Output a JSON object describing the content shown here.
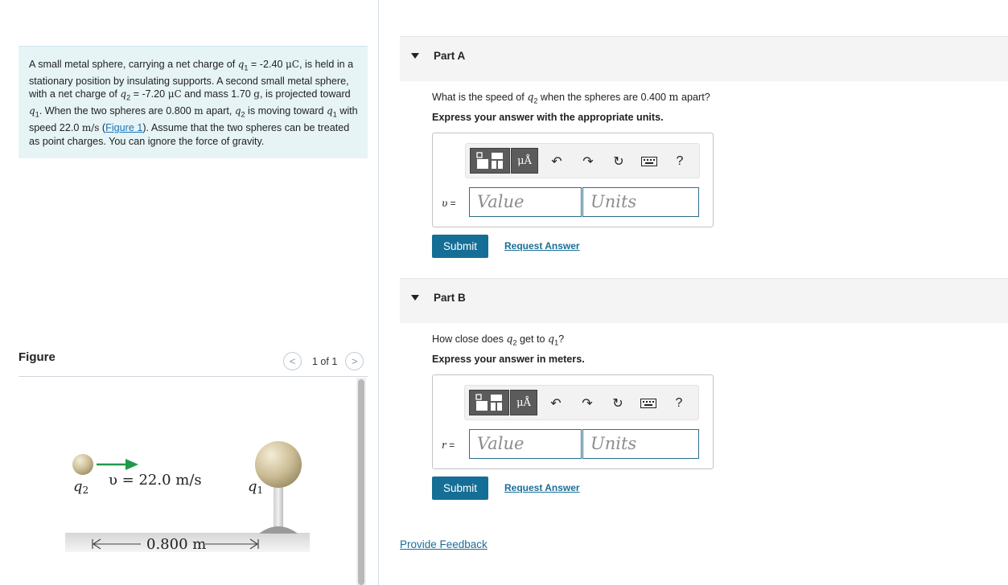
{
  "problem": {
    "t1": "A small metal sphere, carrying a net charge of ",
    "q1": "q",
    "q1sub": "1",
    "t2": " = -2.40 ",
    "unit_uc": "μC",
    "t3": ", is held in a stationary position by insulating supports. A second small metal sphere, with a net charge of ",
    "q2": "q",
    "q2sub": "2",
    "t4": " = -7.20 ",
    "t5": " and mass 1.70 ",
    "unit_g": "g",
    "t6": ", is projected toward ",
    "t7": ". When the two spheres are 0.800 ",
    "unit_m": "m",
    "t8": " apart, ",
    "t9": " is moving toward ",
    "t10": " with speed 22.0 ",
    "unit_ms": "m/s",
    "t11": " (",
    "figure_link": "Figure 1",
    "t12": "). Assume that the two spheres can be treated as point charges. You can ignore the force of gravity."
  },
  "figure": {
    "title": "Figure",
    "count": "1 of 1",
    "prev": "<",
    "next": ">",
    "q2_label": "q",
    "q2_sub": "2",
    "q1_label": "q",
    "q1_sub": "1",
    "speed_label": "υ = 22.0 m/s",
    "distance_label": "0.800 m"
  },
  "partA": {
    "label": "Part A",
    "q_t1": "What is the speed of ",
    "q_var": "q",
    "q_sub": "2",
    "q_t2": " when the spheres are 0.400 ",
    "q_unit": "m",
    "q_t3": " apart?",
    "instruction": "Express your answer with the appropriate units.",
    "var_name": "υ",
    "var_eq": " =",
    "value_placeholder": "Value",
    "units_placeholder": "Units",
    "units_btn": "μÅ",
    "help": "?",
    "submit": "Submit",
    "request": "Request Answer"
  },
  "partB": {
    "label": "Part B",
    "q_t1": "How close does ",
    "q_var": "q",
    "q_sub": "2",
    "q_t2": " get to ",
    "q_var2": "q",
    "q_sub2": "1",
    "q_t3": "?",
    "instruction": "Express your answer in meters.",
    "var_name": "r",
    "var_eq": " =",
    "value_placeholder": "Value",
    "units_placeholder": "Units",
    "units_btn": "μÅ",
    "help": "?",
    "submit": "Submit",
    "request": "Request Answer"
  },
  "feedback": "Provide Feedback",
  "icons": [
    "templates-icon",
    "units-icon",
    "undo-icon",
    "redo-icon",
    "reset-icon",
    "keyboard-icon",
    "help-icon",
    "expand-triangle-icon"
  ]
}
